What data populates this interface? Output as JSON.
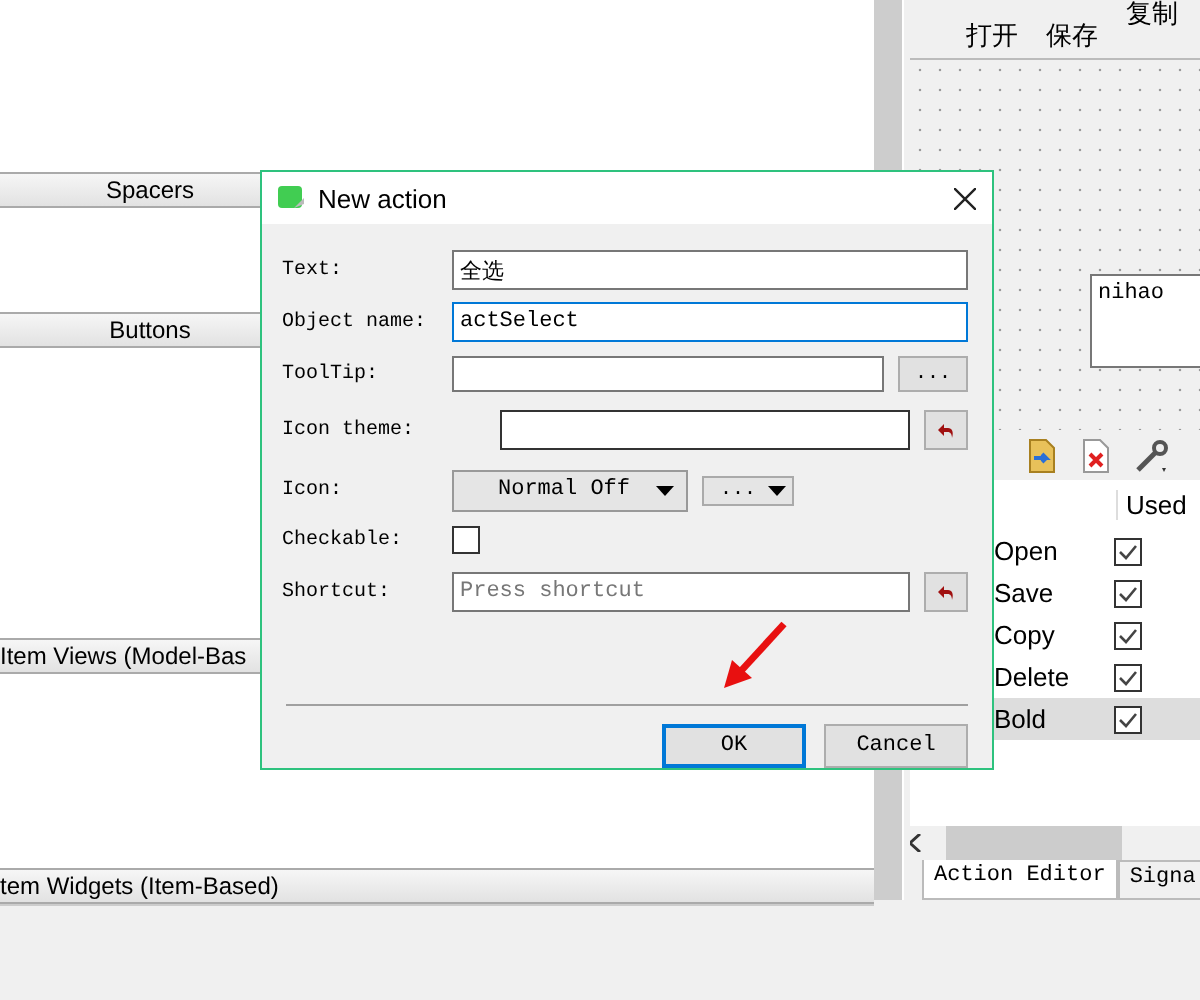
{
  "form_toolbar": {
    "buttons": [
      {
        "label": "打开"
      },
      {
        "label": "保存"
      },
      {
        "label": "复制"
      }
    ]
  },
  "widget_box": {
    "categories": [
      "Spacers",
      "Buttons",
      "Item Views (Model-Bas",
      "tem Widgets (Item-Based)"
    ]
  },
  "form_canvas": {
    "text_edit": {
      "value": "nihao"
    }
  },
  "action_editor": {
    "column": "Used",
    "actions": [
      {
        "name": "Open",
        "used": true,
        "selected": false
      },
      {
        "name": "Save",
        "used": true,
        "selected": false
      },
      {
        "name": "Copy",
        "used": true,
        "selected": false
      },
      {
        "name": "Delete",
        "used": true,
        "selected": false
      },
      {
        "name": "Bold",
        "used": true,
        "selected": true
      }
    ],
    "tabs": [
      {
        "label": "Action Editor",
        "selected": true
      },
      {
        "label": "Signa",
        "selected": false
      }
    ]
  },
  "dialog": {
    "title": "New action",
    "fields": [
      {
        "kind": "text",
        "label": "Text:",
        "value": "全选",
        "focused": false
      },
      {
        "kind": "text",
        "label": "Object name:",
        "value": "actSelect",
        "focused": true
      },
      {
        "kind": "text_button",
        "label": "ToolTip:",
        "button": "..."
      },
      {
        "kind": "text_reset",
        "label": "Icon theme:"
      },
      {
        "kind": "icon",
        "label": "Icon:",
        "value": "Normal Off",
        "button": "..."
      },
      {
        "kind": "checkbox",
        "label": "Checkable:",
        "checked": false
      },
      {
        "kind": "shortcut",
        "label": "Shortcut:",
        "placeholder": "Press shortcut"
      }
    ],
    "buttons": [
      {
        "label": "OK",
        "default": true
      },
      {
        "label": "Cancel",
        "default": false
      }
    ]
  }
}
